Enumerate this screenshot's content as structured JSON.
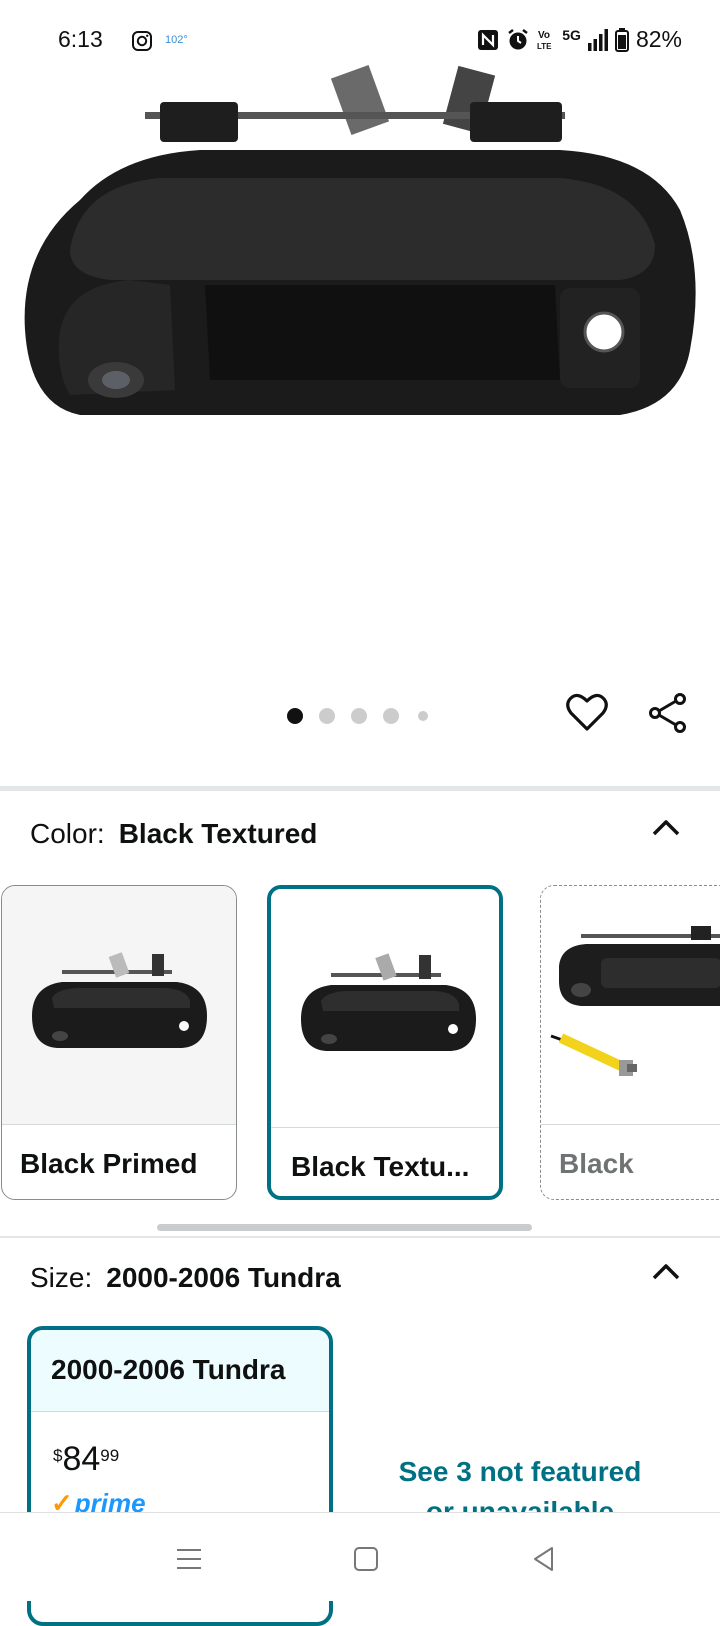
{
  "status": {
    "time": "6:13",
    "temp": "102°",
    "network": "5G",
    "battery": "82%"
  },
  "gallery": {
    "dot_count": 5,
    "active_index": 0
  },
  "color": {
    "label": "Color:",
    "value": "Black Textured"
  },
  "swatches": [
    {
      "label": "Black Primed",
      "state": "normal"
    },
    {
      "label": "Black Textu...",
      "state": "selected"
    },
    {
      "label": "Black",
      "state": "unavailable"
    }
  ],
  "size": {
    "label": "Size:",
    "value": "2000-2006 Tundra"
  },
  "size_option": {
    "label": "2000-2006 Tundra",
    "price_symbol": "$",
    "price_whole": "84",
    "price_fraction": "99",
    "prime": "prime"
  },
  "not_featured": {
    "line1": "See 3 not featured",
    "line2": "or unavailable"
  },
  "colors": {
    "teal": "#007185",
    "prime_blue": "#1a98ff",
    "divider": "#e3e6e6"
  }
}
